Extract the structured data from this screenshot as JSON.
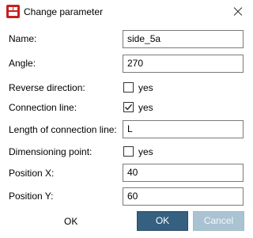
{
  "window": {
    "title": "Change parameter",
    "icon": "app-icon",
    "close_icon": "close-icon"
  },
  "fields": {
    "name": {
      "label": "Name:",
      "value": "side_5a"
    },
    "angle": {
      "label": "Angle:",
      "value": "270"
    },
    "reverse_direction": {
      "label": "Reverse direction:",
      "checkbox_label": "yes",
      "checked": false
    },
    "connection_line": {
      "label": "Connection line:",
      "checkbox_label": "yes",
      "checked": true
    },
    "length_connection_line": {
      "label": "Length of connection line:",
      "value": "L"
    },
    "dimensioning_point": {
      "label": "Dimensioning point:",
      "checkbox_label": "yes",
      "checked": false
    },
    "position_x": {
      "label": "Position X:",
      "value": "40"
    },
    "position_y": {
      "label": "Position Y:",
      "value": "60"
    }
  },
  "footer": {
    "status_text": "OK",
    "ok_label": "OK",
    "cancel_label": "Cancel"
  },
  "colors": {
    "ok_button": "#35607f",
    "cancel_button_disabled": "#aac3d3",
    "app_icon": "#c8201f"
  }
}
